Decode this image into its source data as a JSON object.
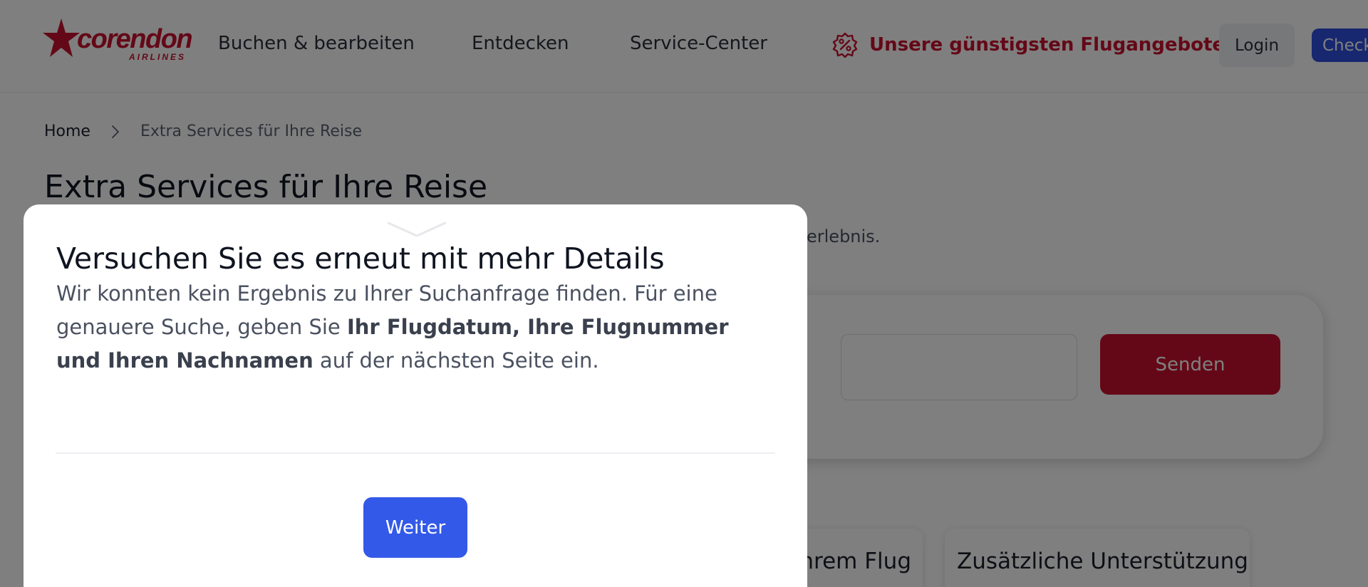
{
  "brand": {
    "logo_text": "corendon",
    "logo_subtext": "AIRLINES",
    "brand_color": "#c8102e"
  },
  "header": {
    "nav": [
      {
        "label": "Buchen & bearbeiten"
      },
      {
        "label": "Entdecken"
      },
      {
        "label": "Service-Center"
      }
    ],
    "promo": {
      "label": "Unsere günstigsten Flugangebote",
      "icon": "percent-badge-icon"
    },
    "login_label": "Login",
    "checkin_label": "Check-in"
  },
  "breadcrumb": {
    "home": "Home",
    "current": "Extra Services für Ihre Reise"
  },
  "page": {
    "title": "Extra Services für Ihre Reise",
    "intro_visible": "erlebnis."
  },
  "search": {
    "input_value": "",
    "submit_label": "Senden"
  },
  "cards": [
    {
      "title": "hrem Flug"
    },
    {
      "title": "Zusätzliche Unterstützung"
    }
  ],
  "modal": {
    "title": "Versuchen Sie es erneut mit mehr Details",
    "body_intro": "Wir konnten kein Ergebnis zu Ihrer Suchanfrage finden. Für eine genauere Suche, geben Sie ",
    "body_emphasis": "Ihr Flugdatum, Ihre Flugnummer und Ihren Nachnamen",
    "body_outro": " auf der nächsten Seite ein.",
    "continue_label": "Weiter"
  },
  "colors": {
    "accent_red": "#c8102e",
    "primary_blue": "#3359e8",
    "overlay": "rgba(0,0,0,0.5)"
  }
}
